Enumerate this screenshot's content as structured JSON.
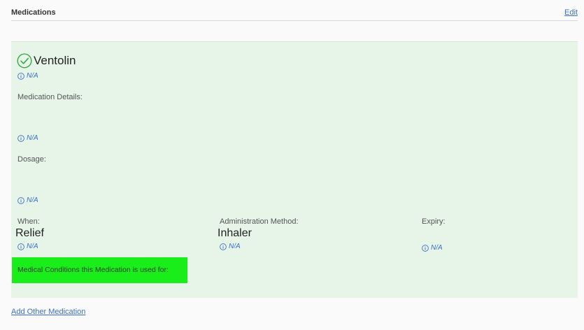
{
  "section": {
    "title": "Medications",
    "edit_label": "Edit"
  },
  "medication": {
    "name": "Ventolin",
    "name_note": "N/A",
    "details_label": "Medication Details:",
    "details_note": "N/A",
    "dosage_label": "Dosage:",
    "dosage_note": "N/A",
    "when_label": "When:",
    "when_value": "Relief",
    "when_note": "N/A",
    "admin_label": "Administration Method:",
    "admin_value": "Inhaler",
    "admin_note": "N/A",
    "expiry_label": "Expiry:",
    "expiry_note": "N/A",
    "conditions_label": "Medical Conditions this Medication is used for:"
  },
  "footer": {
    "add_label": "Add Other Medication"
  },
  "colors": {
    "card_bg": "#e6f5e8",
    "highlight": "#1aee1a",
    "link": "#3b6fc4",
    "check": "#3aa845"
  },
  "icons": {
    "status": "check-circle-icon",
    "note": "info-icon"
  }
}
